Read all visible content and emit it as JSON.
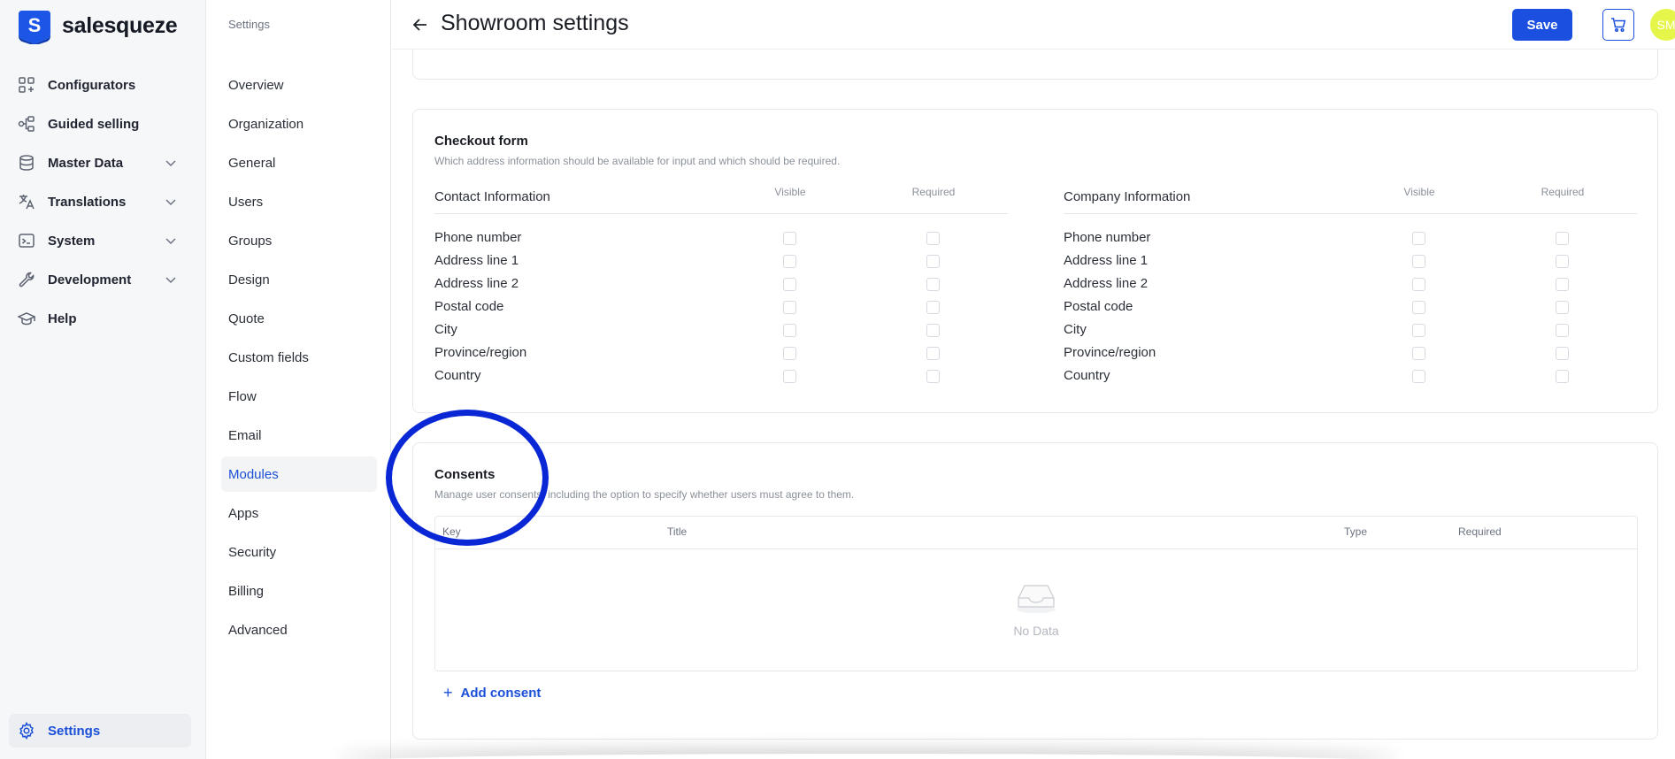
{
  "brand": {
    "name": "salesqueze",
    "logo_letter": "S"
  },
  "nav": {
    "items": [
      {
        "label": "Configurators",
        "icon": "grid-icon"
      },
      {
        "label": "Guided selling",
        "icon": "flow-icon"
      },
      {
        "label": "Master Data",
        "icon": "database-icon",
        "expandable": true
      },
      {
        "label": "Translations",
        "icon": "translate-icon",
        "expandable": true
      },
      {
        "label": "System",
        "icon": "terminal-icon",
        "expandable": true
      },
      {
        "label": "Development",
        "icon": "wrench-icon",
        "expandable": true
      },
      {
        "label": "Help",
        "icon": "graduation-cap-icon"
      }
    ],
    "settings_label": "Settings"
  },
  "subnav": {
    "title": "Settings",
    "items": [
      "Overview",
      "Organization",
      "General",
      "Users",
      "Groups",
      "Design",
      "Quote",
      "Custom fields",
      "Flow",
      "Email",
      "Modules",
      "Apps",
      "Security",
      "Billing",
      "Advanced"
    ],
    "active": "Modules"
  },
  "header": {
    "title": "Showroom settings",
    "save_label": "Save",
    "avatar_initials": "SM"
  },
  "checkout": {
    "title": "Checkout form",
    "description": "Which address information should be available for input and which should be required.",
    "visible_label": "Visible",
    "required_label": "Required",
    "contact": {
      "heading": "Contact Information",
      "fields": [
        "Phone number",
        "Address line 1",
        "Address line 2",
        "Postal code",
        "City",
        "Province/region",
        "Country"
      ]
    },
    "company": {
      "heading": "Company Information",
      "fields": [
        "Phone number",
        "Address line 1",
        "Address line 2",
        "Postal code",
        "City",
        "Province/region",
        "Country"
      ]
    }
  },
  "consents": {
    "title": "Consents",
    "description": "Manage user consents, including the option to specify whether users must agree to them.",
    "columns": [
      "Key",
      "Title",
      "Type",
      "Required"
    ],
    "empty_text": "No Data",
    "add_label": "Add consent"
  },
  "colors": {
    "accent": "#1a4fe0",
    "annotation": "#0a27d6",
    "avatar": "#e6f54a"
  }
}
